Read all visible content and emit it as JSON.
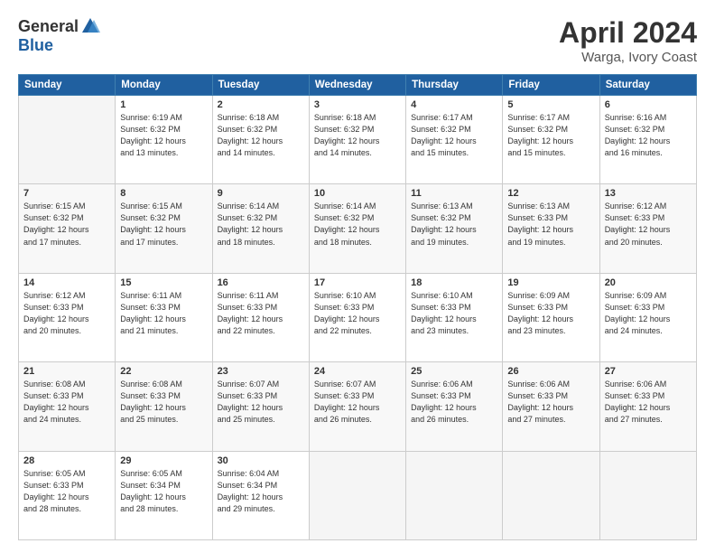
{
  "header": {
    "logo_general": "General",
    "logo_blue": "Blue",
    "title": "April 2024",
    "subtitle": "Warga, Ivory Coast"
  },
  "columns": [
    "Sunday",
    "Monday",
    "Tuesday",
    "Wednesday",
    "Thursday",
    "Friday",
    "Saturday"
  ],
  "weeks": [
    [
      {
        "day": "",
        "info": "",
        "empty": true
      },
      {
        "day": "1",
        "info": "Sunrise: 6:19 AM\nSunset: 6:32 PM\nDaylight: 12 hours\nand 13 minutes."
      },
      {
        "day": "2",
        "info": "Sunrise: 6:18 AM\nSunset: 6:32 PM\nDaylight: 12 hours\nand 14 minutes."
      },
      {
        "day": "3",
        "info": "Sunrise: 6:18 AM\nSunset: 6:32 PM\nDaylight: 12 hours\nand 14 minutes."
      },
      {
        "day": "4",
        "info": "Sunrise: 6:17 AM\nSunset: 6:32 PM\nDaylight: 12 hours\nand 15 minutes."
      },
      {
        "day": "5",
        "info": "Sunrise: 6:17 AM\nSunset: 6:32 PM\nDaylight: 12 hours\nand 15 minutes."
      },
      {
        "day": "6",
        "info": "Sunrise: 6:16 AM\nSunset: 6:32 PM\nDaylight: 12 hours\nand 16 minutes."
      }
    ],
    [
      {
        "day": "7",
        "info": "Sunrise: 6:15 AM\nSunset: 6:32 PM\nDaylight: 12 hours\nand 17 minutes."
      },
      {
        "day": "8",
        "info": "Sunrise: 6:15 AM\nSunset: 6:32 PM\nDaylight: 12 hours\nand 17 minutes."
      },
      {
        "day": "9",
        "info": "Sunrise: 6:14 AM\nSunset: 6:32 PM\nDaylight: 12 hours\nand 18 minutes."
      },
      {
        "day": "10",
        "info": "Sunrise: 6:14 AM\nSunset: 6:32 PM\nDaylight: 12 hours\nand 18 minutes."
      },
      {
        "day": "11",
        "info": "Sunrise: 6:13 AM\nSunset: 6:32 PM\nDaylight: 12 hours\nand 19 minutes."
      },
      {
        "day": "12",
        "info": "Sunrise: 6:13 AM\nSunset: 6:33 PM\nDaylight: 12 hours\nand 19 minutes."
      },
      {
        "day": "13",
        "info": "Sunrise: 6:12 AM\nSunset: 6:33 PM\nDaylight: 12 hours\nand 20 minutes."
      }
    ],
    [
      {
        "day": "14",
        "info": "Sunrise: 6:12 AM\nSunset: 6:33 PM\nDaylight: 12 hours\nand 20 minutes."
      },
      {
        "day": "15",
        "info": "Sunrise: 6:11 AM\nSunset: 6:33 PM\nDaylight: 12 hours\nand 21 minutes."
      },
      {
        "day": "16",
        "info": "Sunrise: 6:11 AM\nSunset: 6:33 PM\nDaylight: 12 hours\nand 22 minutes."
      },
      {
        "day": "17",
        "info": "Sunrise: 6:10 AM\nSunset: 6:33 PM\nDaylight: 12 hours\nand 22 minutes."
      },
      {
        "day": "18",
        "info": "Sunrise: 6:10 AM\nSunset: 6:33 PM\nDaylight: 12 hours\nand 23 minutes."
      },
      {
        "day": "19",
        "info": "Sunrise: 6:09 AM\nSunset: 6:33 PM\nDaylight: 12 hours\nand 23 minutes."
      },
      {
        "day": "20",
        "info": "Sunrise: 6:09 AM\nSunset: 6:33 PM\nDaylight: 12 hours\nand 24 minutes."
      }
    ],
    [
      {
        "day": "21",
        "info": "Sunrise: 6:08 AM\nSunset: 6:33 PM\nDaylight: 12 hours\nand 24 minutes."
      },
      {
        "day": "22",
        "info": "Sunrise: 6:08 AM\nSunset: 6:33 PM\nDaylight: 12 hours\nand 25 minutes."
      },
      {
        "day": "23",
        "info": "Sunrise: 6:07 AM\nSunset: 6:33 PM\nDaylight: 12 hours\nand 25 minutes."
      },
      {
        "day": "24",
        "info": "Sunrise: 6:07 AM\nSunset: 6:33 PM\nDaylight: 12 hours\nand 26 minutes."
      },
      {
        "day": "25",
        "info": "Sunrise: 6:06 AM\nSunset: 6:33 PM\nDaylight: 12 hours\nand 26 minutes."
      },
      {
        "day": "26",
        "info": "Sunrise: 6:06 AM\nSunset: 6:33 PM\nDaylight: 12 hours\nand 27 minutes."
      },
      {
        "day": "27",
        "info": "Sunrise: 6:06 AM\nSunset: 6:33 PM\nDaylight: 12 hours\nand 27 minutes."
      }
    ],
    [
      {
        "day": "28",
        "info": "Sunrise: 6:05 AM\nSunset: 6:33 PM\nDaylight: 12 hours\nand 28 minutes."
      },
      {
        "day": "29",
        "info": "Sunrise: 6:05 AM\nSunset: 6:34 PM\nDaylight: 12 hours\nand 28 minutes."
      },
      {
        "day": "30",
        "info": "Sunrise: 6:04 AM\nSunset: 6:34 PM\nDaylight: 12 hours\nand 29 minutes."
      },
      {
        "day": "",
        "info": "",
        "empty": true
      },
      {
        "day": "",
        "info": "",
        "empty": true
      },
      {
        "day": "",
        "info": "",
        "empty": true
      },
      {
        "day": "",
        "info": "",
        "empty": true
      }
    ]
  ]
}
